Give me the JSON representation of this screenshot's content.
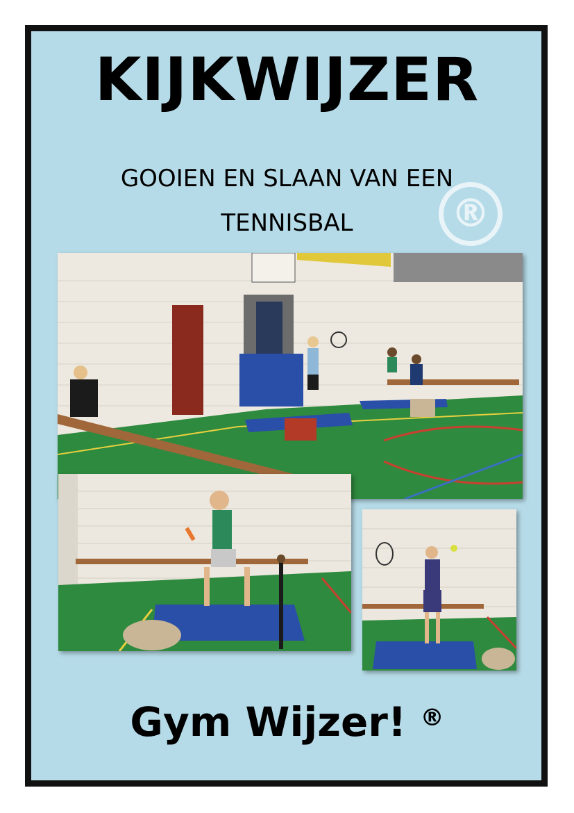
{
  "header": {
    "title": "KIJKWIJZER",
    "subtitle_line1": "GOOIEN EN SLAAN VAN EEN",
    "subtitle_line2": "TENNISBAL"
  },
  "watermark": {
    "symbol": "®"
  },
  "photos": [
    {
      "name": "gym-overview-photo"
    },
    {
      "name": "girl-batting-photo"
    },
    {
      "name": "girl-racket-photo"
    }
  ],
  "footer": {
    "brand": "Gym Wijzer!",
    "registered": "®"
  },
  "colors": {
    "page_background": "#b6dbe8",
    "border": "#111111",
    "gym_floor": "#2e8a3e",
    "mat_blue": "#2a4fa8",
    "wall": "#ece8df"
  }
}
